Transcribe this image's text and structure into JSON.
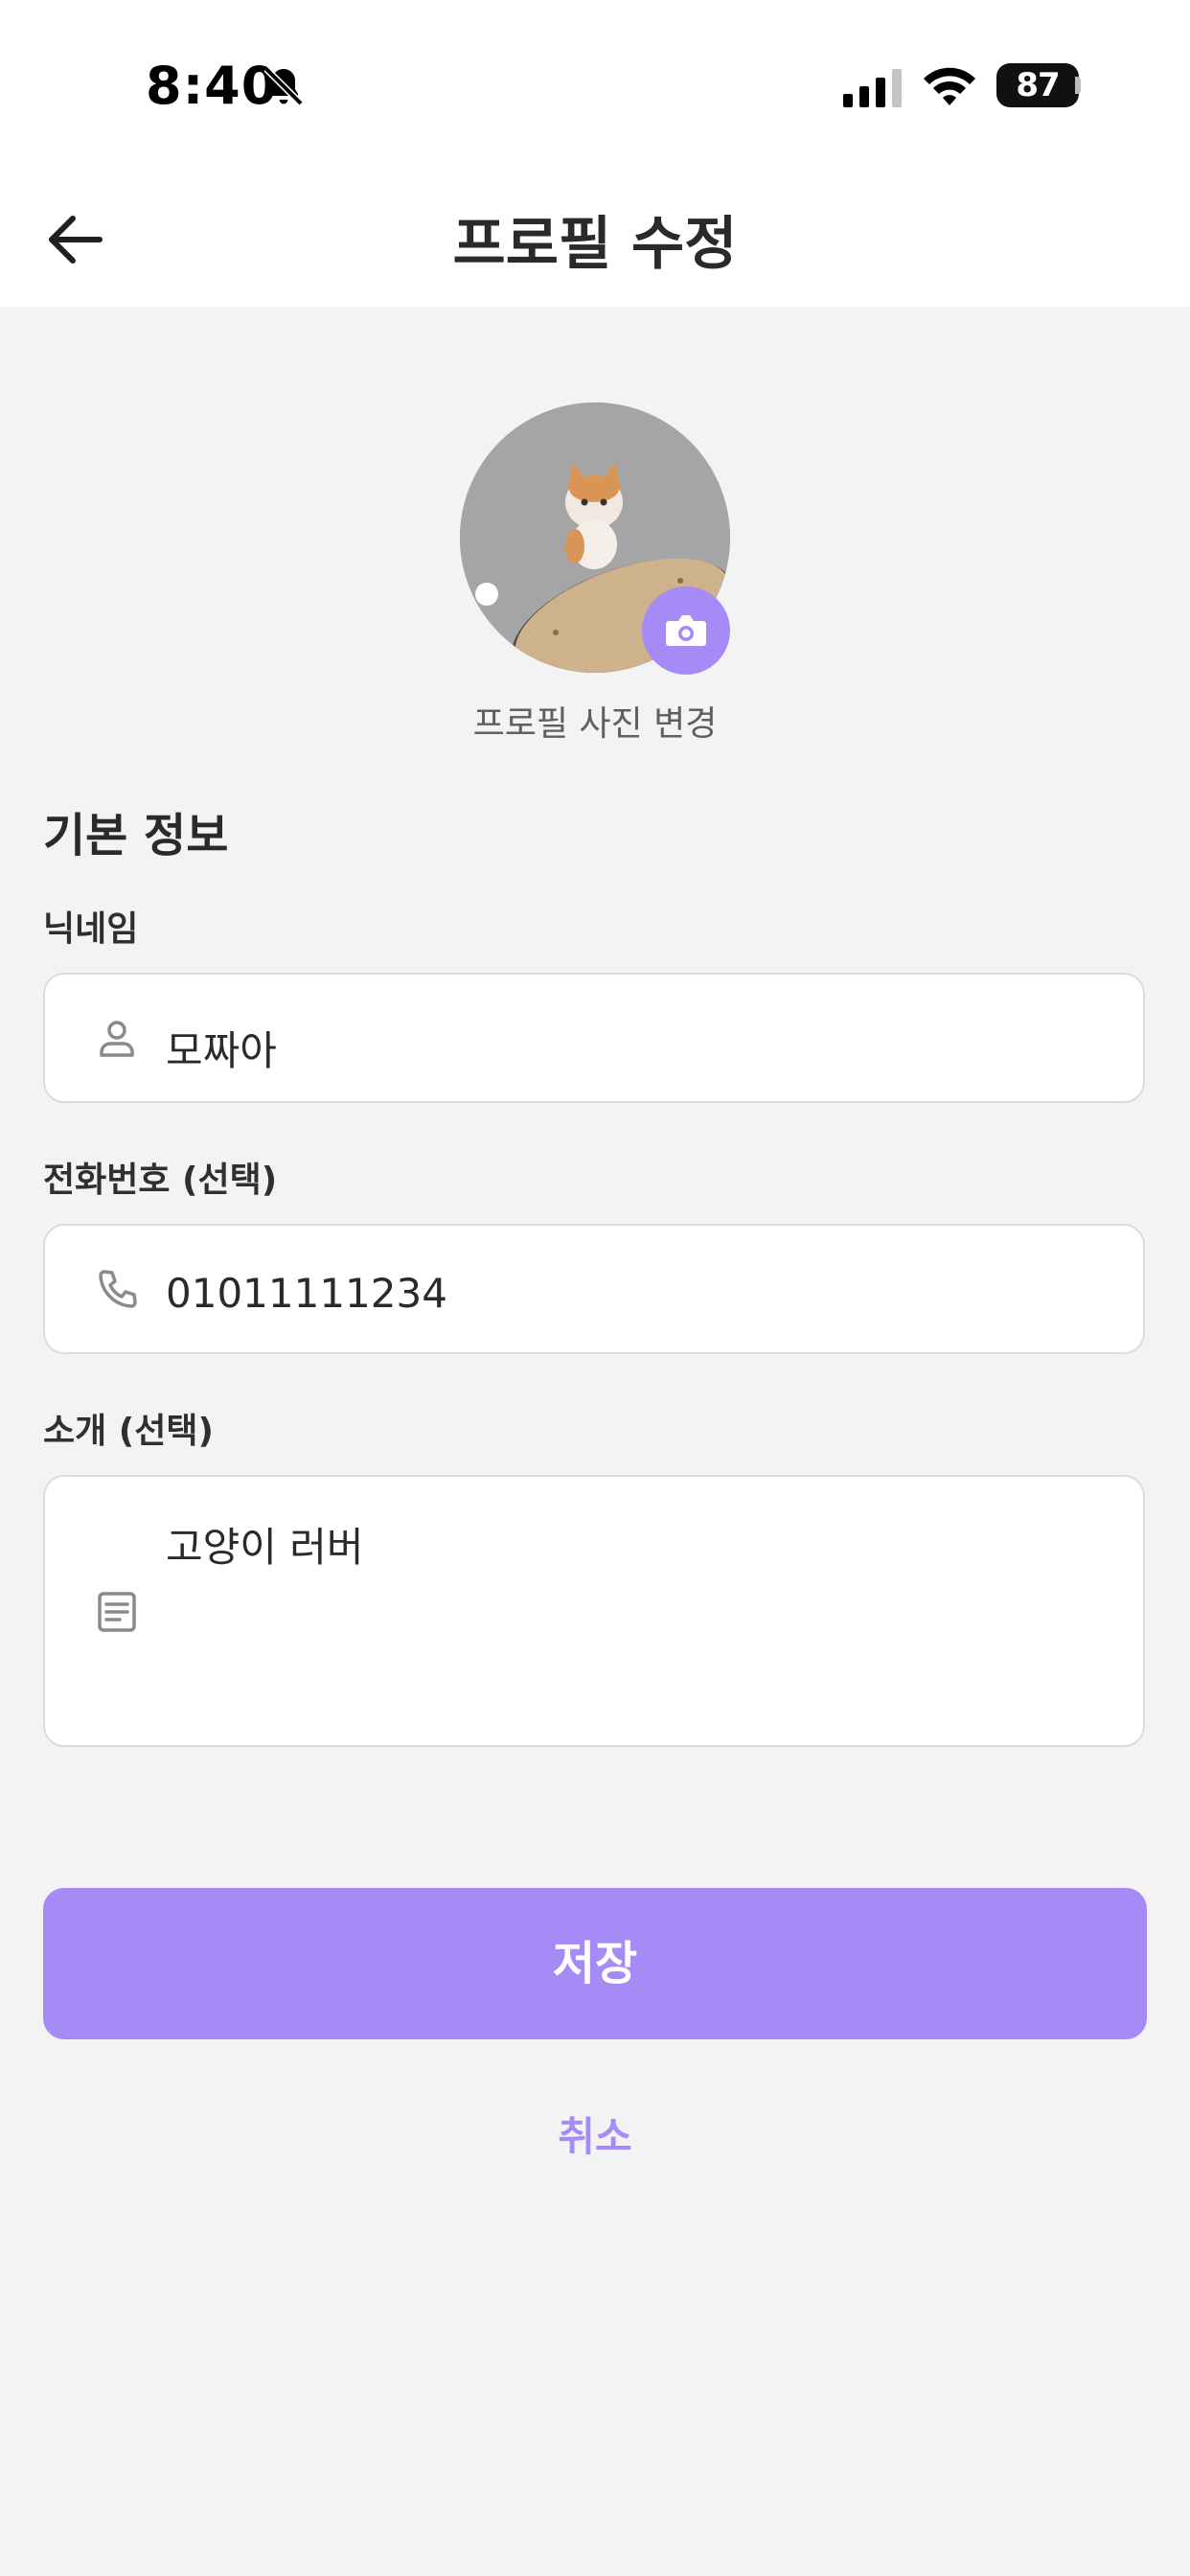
{
  "status_bar": {
    "time": "8:40",
    "battery_level": "87"
  },
  "header": {
    "title": "프로필 수정"
  },
  "profile_photo": {
    "change_label": "프로필 사진 변경"
  },
  "form": {
    "section_title": "기본 정보",
    "nickname": {
      "label": "닉네임",
      "value": "모짜아"
    },
    "phone": {
      "label": "전화번호 (선택)",
      "value": "01011111234"
    },
    "bio": {
      "label": "소개 (선택)",
      "value": "고양이 러버"
    }
  },
  "actions": {
    "save_label": "저장",
    "cancel_label": "취소"
  },
  "colors": {
    "accent": "#a68bf7",
    "background": "#f3f3f4"
  }
}
